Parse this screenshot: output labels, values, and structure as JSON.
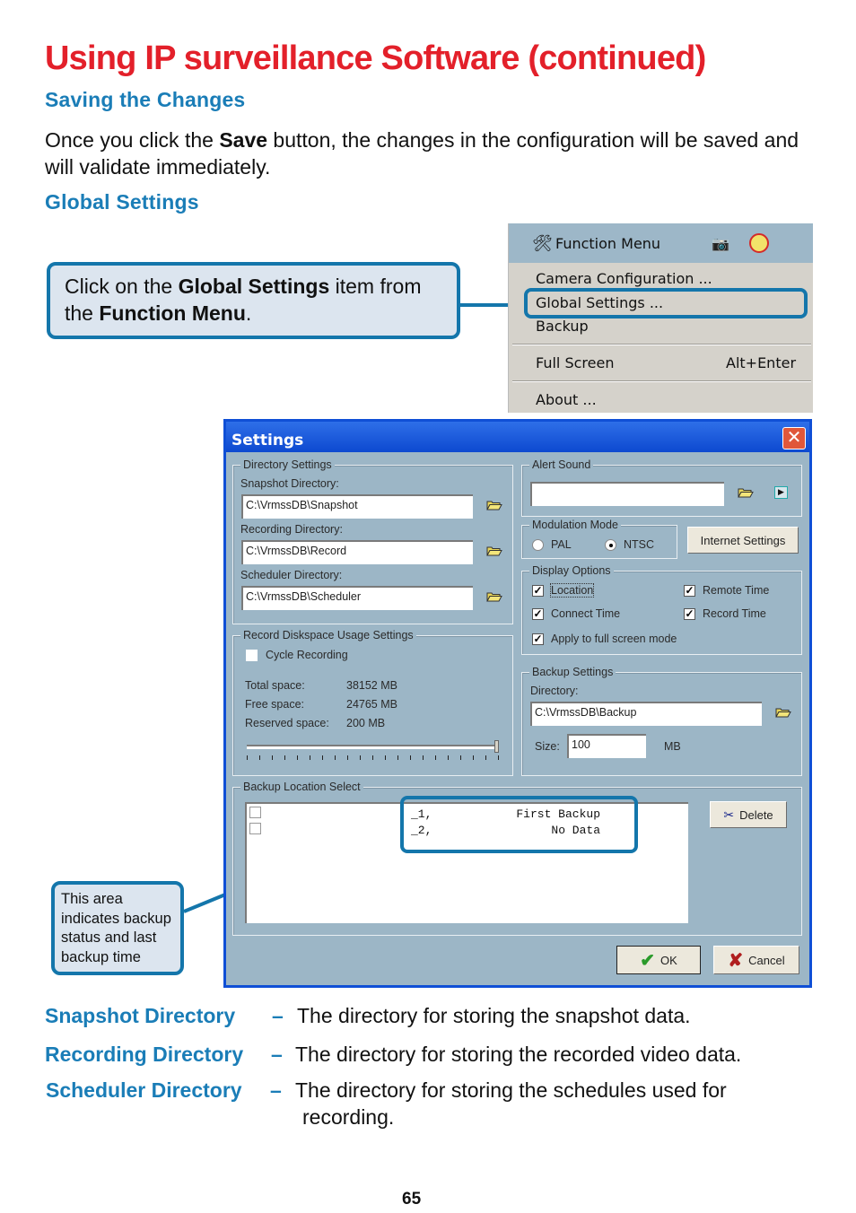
{
  "page": {
    "title": "Using IP surveillance Software (continued)",
    "page_number": "65"
  },
  "sections": {
    "saving": {
      "heading": "Saving  the  Changes",
      "text_before": "Once you click the ",
      "text_bold": "Save",
      "text_after": " button, the changes in the configuration will be saved and will validate immediately."
    },
    "global": {
      "heading": "Global  Settings"
    }
  },
  "callouts": {
    "menu": {
      "t1": "Click on the ",
      "b1": "Global Settings",
      "t2": " item from the ",
      "b2": "Function Menu",
      "t3": "."
    },
    "backup": {
      "text": "This area indicates backup status and last backup time"
    }
  },
  "function_menu": {
    "title": "Function Menu",
    "items": [
      {
        "label": "Camera Configuration ...",
        "shortcut": ""
      },
      {
        "label": "Global Settings ...",
        "shortcut": ""
      },
      {
        "label": "Backup",
        "shortcut": ""
      },
      {
        "label": "Full Screen",
        "shortcut": "Alt+Enter"
      },
      {
        "label": "About ...",
        "shortcut": ""
      }
    ],
    "icons": [
      "tools-icon",
      "camera-icon",
      "no-sound-icon"
    ]
  },
  "settings": {
    "title": "Settings",
    "directory": {
      "group": "Directory Settings",
      "snapshot_label": "Snapshot Directory:",
      "snapshot_value": "C:\\VrmssDB\\Snapshot",
      "recording_label": "Recording Directory:",
      "recording_value": "C:\\VrmssDB\\Record",
      "scheduler_label": "Scheduler Directory:",
      "scheduler_value": "C:\\VrmssDB\\Scheduler"
    },
    "diskspace": {
      "group": "Record Diskspace Usage Settings",
      "cycle_label": "Cycle Recording",
      "cycle_checked": false,
      "total_label": "Total space:",
      "total_value": "38152 MB",
      "free_label": "Free space:",
      "free_value": "24765 MB",
      "reserved_label": "Reserved space:",
      "reserved_value": "200 MB",
      "slider_fraction": 1.0
    },
    "alert": {
      "group": "Alert Sound",
      "value": ""
    },
    "modulation": {
      "group": "Modulation Mode",
      "options": [
        "PAL",
        "NTSC"
      ],
      "selected": "NTSC",
      "internet_button": "Internet Settings"
    },
    "display": {
      "group": "Display Options",
      "options": [
        {
          "label": "Location",
          "checked": true
        },
        {
          "label": "Remote Time",
          "checked": true
        },
        {
          "label": "Connect Time",
          "checked": true
        },
        {
          "label": "Record Time",
          "checked": true
        },
        {
          "label": "Apply to full screen mode",
          "checked": true
        }
      ]
    },
    "backup": {
      "group": "Backup Settings",
      "dir_label": "Directory:",
      "dir_value": "C:\\VrmssDB\\Backup",
      "size_label": "Size:",
      "size_value": "100",
      "size_unit": "MB"
    },
    "backup_location": {
      "group": "Backup Location Select",
      "rows": [
        {
          "id": "_1,",
          "status": "First Backup",
          "checked": false
        },
        {
          "id": "_2,",
          "status": "No Data",
          "checked": false
        }
      ],
      "delete_button": "Delete"
    },
    "ok_button": "OK",
    "cancel_button": "Cancel"
  },
  "definitions": [
    {
      "term": "Snapshot Directory",
      "dash": "–",
      "desc": "The directory for storing the snapshot data."
    },
    {
      "term": "Recording Directory",
      "dash": "–",
      "desc": "The directory for storing the recorded video data."
    },
    {
      "term": "Scheduler Directory",
      "dash": "–",
      "desc": "The directory for storing the schedules used for",
      "desc2": "recording."
    }
  ],
  "colors": {
    "title_red": "#e3202a",
    "heading_blue": "#1a7db7",
    "callout_border": "#1476ab",
    "window_blue": "#0f4fd6",
    "dialog_bg": "#9cb6c6"
  }
}
